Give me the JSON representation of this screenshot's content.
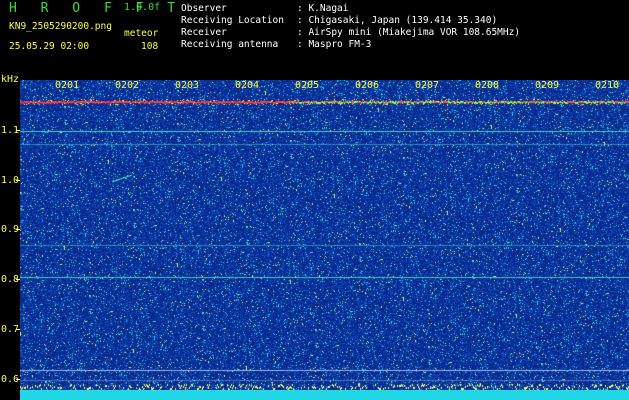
{
  "header": {
    "app_name": "H R O F F T",
    "version": "1.0.0f",
    "filename": "KN9_2505290200.png",
    "datetime": "25.05.29 02:00",
    "mode_label": "meteor",
    "count": "108",
    "info": [
      {
        "label": "Observer",
        "value": ": K.Nagai"
      },
      {
        "label": "Receiving Location",
        "value": ": Chigasaki, Japan (139.414 35.340)"
      },
      {
        "label": "Receiver",
        "value": ": AirSpy mini (Miakejima VOR 108.65MHz)"
      },
      {
        "label": "Receiving antenna",
        "value": ": Maspro FM-3"
      }
    ]
  },
  "axis": {
    "unit": "kHz",
    "y_labels": [
      "1.1",
      "1.0",
      "0.9",
      "0.8",
      "0.7",
      "0.6"
    ],
    "time_labels": [
      "0201",
      "0202",
      "0203",
      "0204",
      "0205",
      "0206",
      "0207",
      "0208",
      "0209",
      "0210"
    ]
  },
  "colors": {
    "text_green": "#3ddc3d",
    "axis_yellow": "#ffff40",
    "background": "#000000",
    "plot_blue": "#0b2c86",
    "noise_cyan": "#21d7e6",
    "carrier_red": "#ff3030"
  }
}
